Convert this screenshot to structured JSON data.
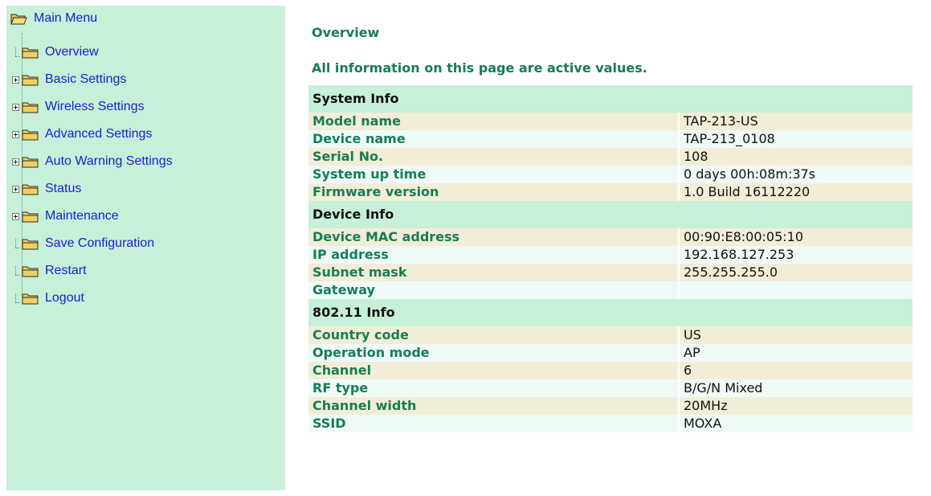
{
  "sidebar": {
    "root_label": "Main Menu",
    "items": [
      {
        "label": "Overview",
        "expandable": false
      },
      {
        "label": "Basic Settings",
        "expandable": true
      },
      {
        "label": "Wireless Settings",
        "expandable": true
      },
      {
        "label": "Advanced Settings",
        "expandable": true
      },
      {
        "label": "Auto Warning Settings",
        "expandable": true
      },
      {
        "label": "Status",
        "expandable": true
      },
      {
        "label": "Maintenance",
        "expandable": true
      },
      {
        "label": "Save Configuration",
        "expandable": false
      },
      {
        "label": "Restart",
        "expandable": false
      },
      {
        "label": "Logout",
        "expandable": false
      }
    ]
  },
  "main": {
    "title": "Overview",
    "notice": "All information on this page are active values.",
    "sections": [
      {
        "header": "System Info",
        "rows": [
          {
            "key": "Model name",
            "value": "TAP-213-US"
          },
          {
            "key": "Device name",
            "value": "TAP-213_0108"
          },
          {
            "key": "Serial No.",
            "value": "108"
          },
          {
            "key": "System up time",
            "value": "0 days 00h:08m:37s"
          },
          {
            "key": "Firmware version",
            "value": "1.0 Build 16112220"
          }
        ]
      },
      {
        "header": "Device Info",
        "rows": [
          {
            "key": "Device MAC address",
            "value": "00:90:E8:00:05:10"
          },
          {
            "key": "IP address",
            "value": "192.168.127.253"
          },
          {
            "key": "Subnet mask",
            "value": "255.255.255.0"
          },
          {
            "key": "Gateway",
            "value": ""
          }
        ]
      },
      {
        "header": "802.11 Info",
        "rows": [
          {
            "key": "Country code",
            "value": "US"
          },
          {
            "key": "Operation mode",
            "value": "AP"
          },
          {
            "key": "Channel",
            "value": "6"
          },
          {
            "key": "RF type",
            "value": "B/G/N Mixed"
          },
          {
            "key": "Channel width",
            "value": "20MHz"
          },
          {
            "key": "SSID",
            "value": "MOXA",
            "link": true
          }
        ]
      }
    ]
  },
  "colors": {
    "sidebar_bg": "#c6f0d8",
    "link_blue": "#1c1cd4",
    "heading_green": "#167e54",
    "row_odd": "#f2edd7",
    "row_even": "#eefaf8",
    "folder_yellow": "#f0d060"
  },
  "icons": {
    "root": "folder-open-icon",
    "item": "folder-icon",
    "expander": "plus-box-icon"
  }
}
